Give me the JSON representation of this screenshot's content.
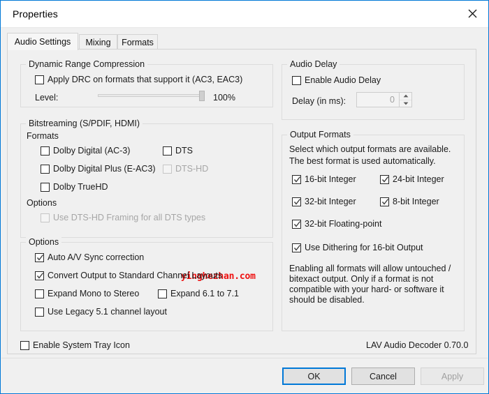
{
  "window": {
    "title": "Properties",
    "close_icon": "close-icon",
    "accent_color": "#0078d7"
  },
  "tabs": [
    {
      "label": "Audio Settings",
      "active": true
    },
    {
      "label": "Mixing",
      "active": false
    },
    {
      "label": "Formats",
      "active": false
    }
  ],
  "drc": {
    "group_label": "Dynamic Range Compression",
    "apply_label": "Apply DRC on formats that support it (AC3, EAC3)",
    "apply_checked": false,
    "level_label": "Level:",
    "level_value": "100%",
    "level_percent": 100
  },
  "bitstreaming": {
    "group_label": "Bitstreaming (S/PDIF, HDMI)",
    "formats_label": "Formats",
    "options_label": "Options",
    "formats": [
      {
        "label": "Dolby Digital (AC-3)",
        "checked": false,
        "disabled": false
      },
      {
        "label": "Dolby Digital Plus (E-AC3)",
        "checked": false,
        "disabled": false
      },
      {
        "label": "Dolby TrueHD",
        "checked": false,
        "disabled": false
      },
      {
        "label": "DTS",
        "checked": false,
        "disabled": false
      },
      {
        "label": "DTS-HD",
        "checked": false,
        "disabled": true
      }
    ],
    "options": [
      {
        "label": "Use DTS-HD Framing for all DTS types",
        "checked": false,
        "disabled": true
      }
    ]
  },
  "options": {
    "group_label": "Options",
    "items": [
      {
        "label": "Auto A/V Sync correction",
        "checked": true,
        "disabled": false
      },
      {
        "label": "Convert Output to Standard Channel Layouts",
        "checked": true,
        "disabled": false
      },
      {
        "label": "Expand Mono to Stereo",
        "checked": false,
        "disabled": false
      },
      {
        "label": "Expand 6.1 to 7.1",
        "checked": false,
        "disabled": false
      },
      {
        "label": "Use Legacy 5.1 channel layout",
        "checked": false,
        "disabled": false
      }
    ]
  },
  "tray": {
    "label": "Enable System Tray Icon",
    "checked": false
  },
  "audio_delay": {
    "group_label": "Audio Delay",
    "enable_label": "Enable Audio Delay",
    "enable_checked": false,
    "delay_label": "Delay (in ms):",
    "delay_value": "0",
    "delay_disabled": true
  },
  "output_formats": {
    "group_label": "Output Formats",
    "description_line1": "Select which output formats are available.",
    "description_line2": "The best format is used automatically.",
    "items": [
      {
        "label": "16-bit Integer",
        "checked": true
      },
      {
        "label": "24-bit Integer",
        "checked": true
      },
      {
        "label": "32-bit Integer",
        "checked": true
      },
      {
        "label": "8-bit Integer",
        "checked": true
      },
      {
        "label": "32-bit Floating-point",
        "checked": true
      },
      {
        "label": "Use Dithering for 16-bit Output",
        "checked": true
      }
    ],
    "note": "Enabling all formats will allow untouched / bitexact output. Only if a format is not compatible with your hard- or software it should be disabled."
  },
  "version_text": "LAV Audio Decoder 0.70.0",
  "footer": {
    "ok_label": "OK",
    "cancel_label": "Cancel",
    "apply_label": "Apply",
    "apply_disabled": true
  },
  "watermark": {
    "text": "yinghezhan.com",
    "color": "#ee1111"
  }
}
